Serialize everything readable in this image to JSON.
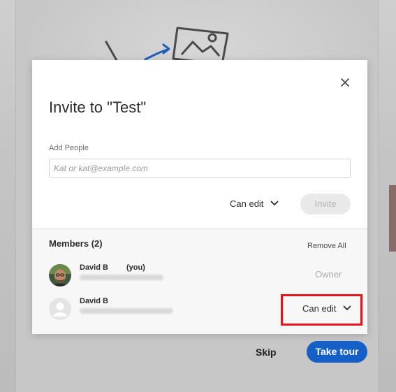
{
  "backdrop": {
    "skip_label": "Skip",
    "take_tour_label": "Take tour",
    "illustration_icons": [
      "paintbrush-icon",
      "arrow-icon",
      "image-icon"
    ],
    "accent_color": "#1560c6"
  },
  "dialog": {
    "title": "Invite to \"Test\"",
    "close_icon": "close-icon",
    "add_people": {
      "label": "Add People",
      "placeholder": "Kat or kat@example.com",
      "value": ""
    },
    "permission": {
      "selected": "Can edit",
      "icon": "chevron-down-icon"
    },
    "invite_label": "Invite",
    "members": {
      "heading": "Members (2)",
      "remove_all_label": "Remove All",
      "list": [
        {
          "name": "David B",
          "suffix": "(you)",
          "role": "Owner",
          "avatar": "photo-avatar"
        },
        {
          "name": "David B",
          "role": "Can edit",
          "avatar": "placeholder-avatar"
        }
      ]
    }
  },
  "annotation": {
    "highlight_color": "#e8141c"
  }
}
